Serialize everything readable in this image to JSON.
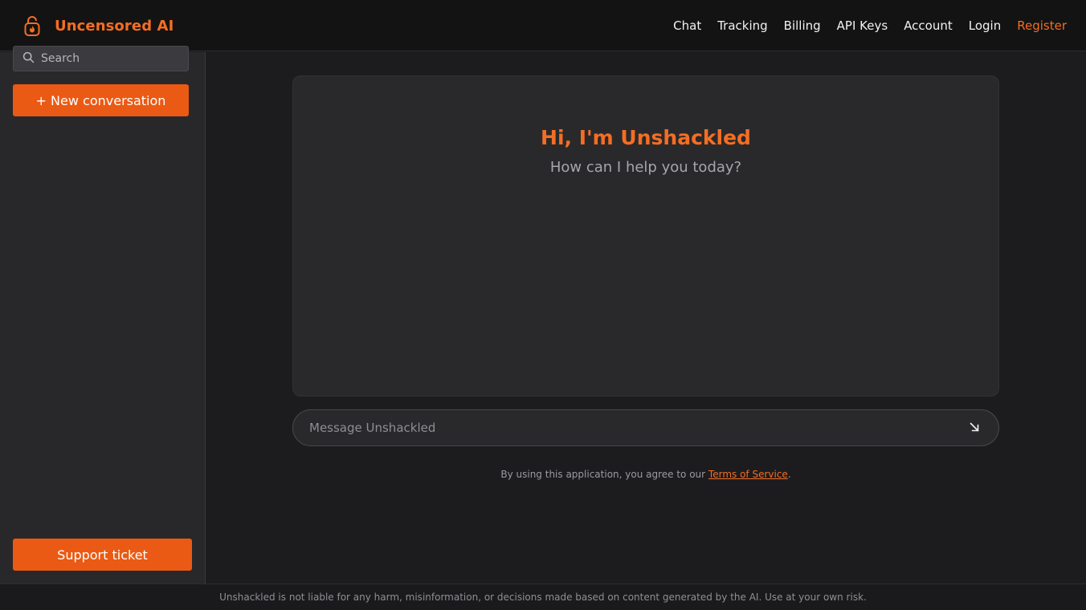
{
  "header": {
    "brand_name": "Uncensored AI",
    "brand_icon": "lock-flame-icon",
    "nav": [
      {
        "label": "Chat"
      },
      {
        "label": "Tracking"
      },
      {
        "label": "Billing"
      },
      {
        "label": "API Keys"
      },
      {
        "label": "Account"
      },
      {
        "label": "Login"
      },
      {
        "label": "Register",
        "accent": true
      }
    ]
  },
  "sidebar": {
    "search": {
      "placeholder": "Search",
      "value": "",
      "icon": "search-icon"
    },
    "new_conversation_label": "+ New conversation",
    "support_label": "Support ticket"
  },
  "main": {
    "greeting": "Hi, I'm Unshackled",
    "subtitle": "How can I help you today?",
    "composer": {
      "placeholder": "Message Unshackled",
      "value": "",
      "send_icon": "arrow-down-right-icon"
    },
    "tos": {
      "prefix": "By using this application, you agree to our ",
      "link_label": "Terms of Service",
      "suffix": "."
    }
  },
  "footer": {
    "disclaimer": "Unshackled is not liable for any harm, misinformation, or decisions made based on content generated by the AI. Use at your own risk."
  },
  "colors": {
    "accent": "#f46e22",
    "button": "#ea5a14",
    "background": "#1c1c1f",
    "panel": "#29292c"
  }
}
